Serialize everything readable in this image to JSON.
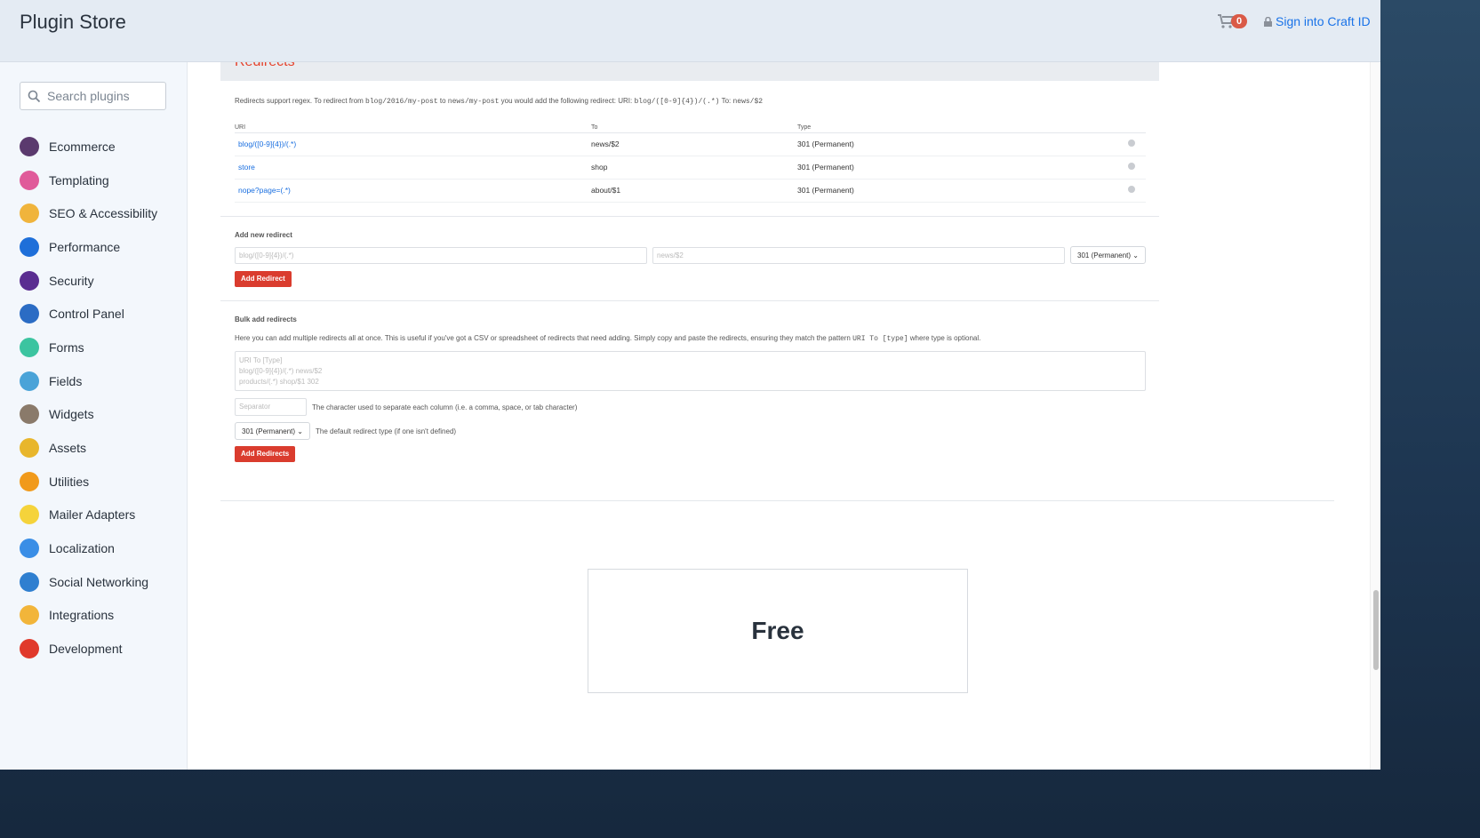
{
  "header": {
    "title": "Plugin Store",
    "cart_count": "0",
    "signin": "Sign into Craft ID"
  },
  "sidebar": {
    "search_placeholder": "Search plugins",
    "items": [
      {
        "label": "Ecommerce",
        "color": "#5b3a6e"
      },
      {
        "label": "Templating",
        "color": "#e05a9a"
      },
      {
        "label": "SEO & Accessibility",
        "color": "#f0b43c"
      },
      {
        "label": "Performance",
        "color": "#1e6fd9"
      },
      {
        "label": "Security",
        "color": "#5a2d91"
      },
      {
        "label": "Control Panel",
        "color": "#2b6cc4"
      },
      {
        "label": "Forms",
        "color": "#3cc4a0"
      },
      {
        "label": "Fields",
        "color": "#4aa3d8"
      },
      {
        "label": "Widgets",
        "color": "#8a7a6a"
      },
      {
        "label": "Assets",
        "color": "#e8b62c"
      },
      {
        "label": "Utilities",
        "color": "#f19a1b"
      },
      {
        "label": "Mailer Adapters",
        "color": "#f5d33b"
      },
      {
        "label": "Localization",
        "color": "#3a8ee6"
      },
      {
        "label": "Social Networking",
        "color": "#2f7fd0"
      },
      {
        "label": "Integrations",
        "color": "#f2b53a"
      },
      {
        "label": "Development",
        "color": "#e0392b"
      }
    ]
  },
  "redirects": {
    "title": "Redirects",
    "desc_1": "Redirects support regex. To redirect from ",
    "code_1": "blog/2016/my-post",
    "desc_2": " to ",
    "code_2": "news/my-post",
    "desc_3": " you would add the following redirect: URI: ",
    "code_3": "blog/([0-9]{4})/(.*)",
    "desc_4": " To: ",
    "code_4": "news/$2",
    "columns": [
      "URI",
      "To",
      "Type"
    ],
    "rows": [
      {
        "uri": "blog/([0-9]{4})/(.*)",
        "to": "news/$2",
        "type": "301 (Permanent)"
      },
      {
        "uri": "store",
        "to": "shop",
        "type": "301 (Permanent)"
      },
      {
        "uri": "nope?page=(.*)",
        "to": "about/$1",
        "type": "301 (Permanent)"
      }
    ]
  },
  "add_new": {
    "label": "Add new redirect",
    "uri_placeholder": "blog/([0-9]{4})/(.*)",
    "to_placeholder": "news/$2",
    "type": "301 (Permanent)",
    "button": "Add Redirect"
  },
  "bulk": {
    "label": "Bulk add redirects",
    "desc_1": "Here you can add multiple redirects all at once. This is useful if you've got a CSV or spreadsheet of redirects that need adding. Simply copy and paste the redirects, ensuring they match the pattern ",
    "code": "URI To [type]",
    "desc_2": " where type is optional.",
    "textarea_placeholder": "URI To [Type]\nblog/([0-9]{4})/(.*) news/$2\nproducts/(.*) shop/$1 302",
    "separator_placeholder": "Separator",
    "separator_help": "The character used to separate each column (i.e. a comma, space, or tab character)",
    "type": "301 (Permanent)",
    "type_help": "The default redirect type (if one isn't defined)",
    "button": "Add Redirects"
  },
  "pricing": {
    "label": "Free"
  }
}
